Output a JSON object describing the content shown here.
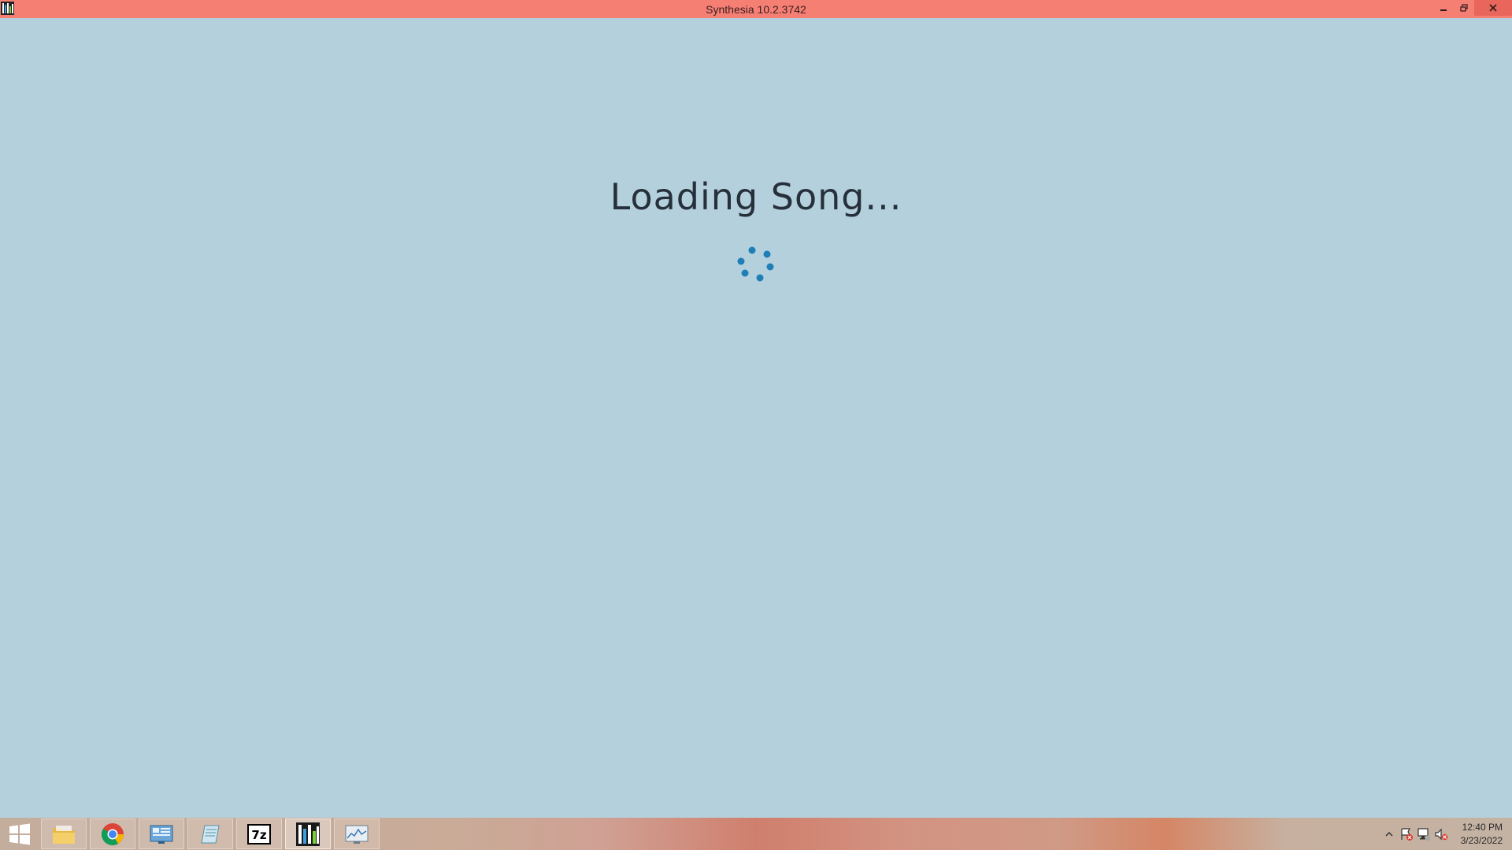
{
  "window": {
    "title": "Synthesia 10.2.3742",
    "controls": [
      "minimize-icon",
      "restore-icon",
      "close-icon"
    ]
  },
  "main": {
    "status_text": "Loading Song..."
  },
  "taskbar": {
    "apps": [
      {
        "name": "file-explorer-icon",
        "state": "pinned"
      },
      {
        "name": "chrome-icon",
        "state": "pinned"
      },
      {
        "name": "control-panel-icon",
        "state": "pinned"
      },
      {
        "name": "notepad-icon",
        "state": "pinned"
      },
      {
        "name": "7zip-icon",
        "state": "pinned",
        "label": "7z"
      },
      {
        "name": "synthesia-icon",
        "state": "active"
      },
      {
        "name": "resource-monitor-icon",
        "state": "pinned"
      }
    ],
    "tray": {
      "icons": [
        "show-hidden-icons-icon",
        "action-center-icon",
        "network-icon",
        "volume-muted-icon"
      ],
      "time": "12:40 PM",
      "date": "3/23/2022"
    }
  },
  "colors": {
    "titlebar": "#f67f74",
    "background": "#b5d0dd",
    "spinner_dots": "#1e7eb5",
    "text": "#26303a"
  }
}
